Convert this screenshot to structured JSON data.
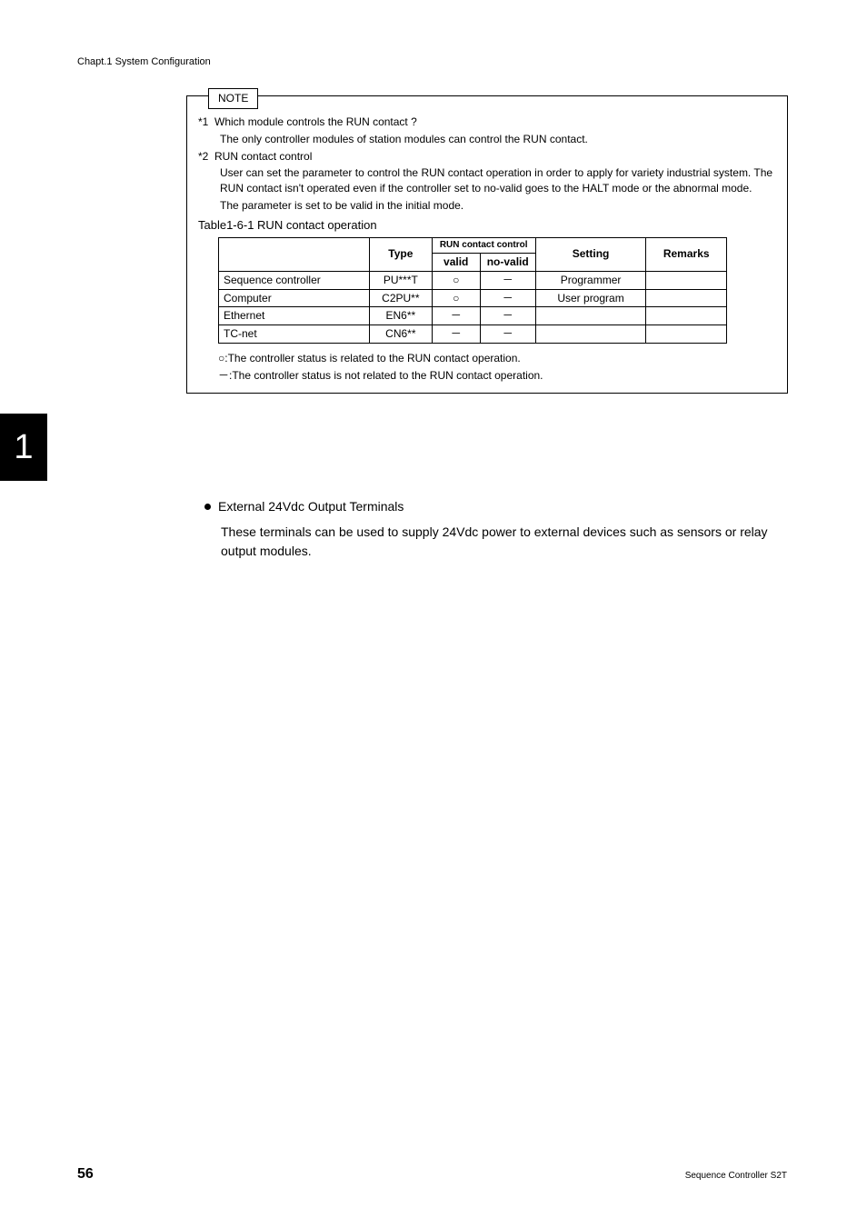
{
  "header": "Chapt.1  System Configuration",
  "note": {
    "label": "NOTE",
    "item1_prefix": "*1",
    "item1_title": "Which module controls the RUN contact ?",
    "item1_body": "The only controller modules of station modules can control the RUN contact.",
    "item2_prefix": "*2",
    "item2_title": "RUN contact control",
    "item2_body1": "User can set the parameter to control the RUN contact operation in order to apply for variety industrial system. The RUN contact isn't operated even if the controller set to no-valid goes to the HALT mode or the abnormal mode.",
    "item2_body2": "The parameter is set to be valid in the initial mode.",
    "table_caption": "Table1-6-1    RUN contact operation",
    "legend1": "○:The controller status is related to the RUN contact operation.",
    "legend2": "－:The controller status is not related to the RUN contact operation."
  },
  "table": {
    "h_type": "Type",
    "h_runcc": "RUN contact control",
    "h_valid": "valid",
    "h_novalid": "no-valid",
    "h_setting": "Setting",
    "h_remarks": "Remarks",
    "rows": [
      {
        "name": "Sequence controller",
        "type": "PU***T",
        "valid": "○",
        "novalid": "－",
        "setting": "Programmer",
        "remarks": ""
      },
      {
        "name": "Computer",
        "type": "C2PU**",
        "valid": "○",
        "novalid": "－",
        "setting": "User program",
        "remarks": ""
      },
      {
        "name": "Ethernet",
        "type": "EN6**",
        "valid": "－",
        "novalid": "－",
        "setting": "",
        "remarks": ""
      },
      {
        "name": "TC-net",
        "type": "CN6**",
        "valid": "－",
        "novalid": "－",
        "setting": "",
        "remarks": ""
      }
    ]
  },
  "chapter_tab": "1",
  "section": {
    "title": "External 24Vdc Output Terminals",
    "body": "These terminals can be used to supply 24Vdc power to external devices such as sensors or relay output modules."
  },
  "page_number": "56",
  "footer_right": "Sequence Controller S2T"
}
